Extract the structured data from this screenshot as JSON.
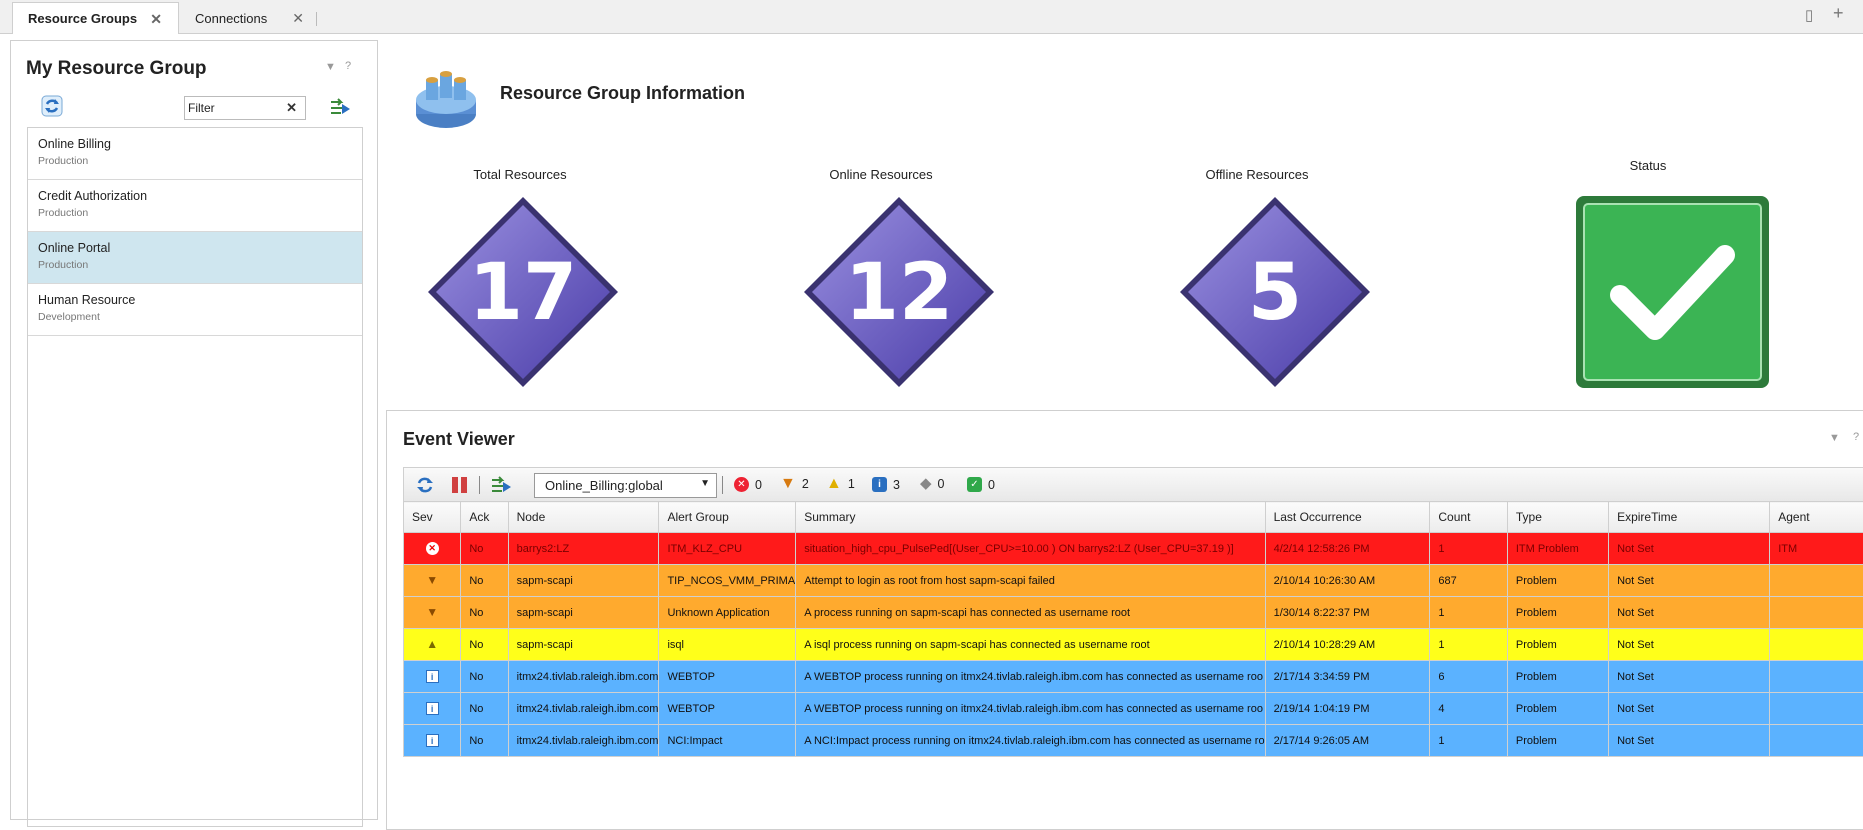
{
  "tabs": [
    {
      "label": "Resource Groups"
    },
    {
      "label": "Connections"
    }
  ],
  "left_panel": {
    "title": "My Resource Group",
    "filter_value": "Filter",
    "groups": [
      {
        "name": "Online Billing",
        "env": "Production"
      },
      {
        "name": "Credit Authorization",
        "env": "Production"
      },
      {
        "name": "Online Portal",
        "env": "Production"
      },
      {
        "name": "Human Resource",
        "env": "Development"
      }
    ]
  },
  "info": {
    "title": "Resource Group Information",
    "metrics": [
      {
        "label": "Total Resources",
        "value": "17"
      },
      {
        "label": "Online Resources",
        "value": "12"
      },
      {
        "label": "Offline Resources",
        "value": "5"
      }
    ],
    "status_label": "Status"
  },
  "event_viewer": {
    "title": "Event Viewer",
    "filter_select": "Online_Billing:global",
    "counts": {
      "critical": "0",
      "major": "2",
      "minor": "1",
      "info": "3",
      "indeterminate": "0",
      "clear": "0"
    },
    "columns": [
      "Sev",
      "Ack",
      "Node",
      "Alert Group",
      "Summary",
      "Last Occurrence",
      "Count",
      "Type",
      "ExpireTime",
      "Agent"
    ],
    "rows": [
      {
        "sev": "critical",
        "ack": "No",
        "node": "barrys2:LZ",
        "group": "ITM_KLZ_CPU",
        "summary": "situation_high_cpu_PulsePed[(User_CPU>=10.00 ) ON barrys2:LZ (User_CPU=37.19 )]",
        "last": "4/2/14 12:58:26 PM",
        "count": "1",
        "type": "ITM Problem",
        "expire": "Not Set",
        "agent": "ITM"
      },
      {
        "sev": "major",
        "ack": "No",
        "node": "sapm-scapi",
        "group": "TIP_NCOS_VMM_PRIMA",
        "summary": "Attempt to login as root from host sapm-scapi failed",
        "last": "2/10/14 10:26:30 AM",
        "count": "687",
        "type": "Problem",
        "expire": "Not Set",
        "agent": ""
      },
      {
        "sev": "major",
        "ack": "No",
        "node": "sapm-scapi",
        "group": "Unknown Application",
        "summary": "A process running on sapm-scapi has connected as username root",
        "last": "1/30/14 8:22:37 PM",
        "count": "1",
        "type": "Problem",
        "expire": "Not Set",
        "agent": ""
      },
      {
        "sev": "minor",
        "ack": "No",
        "node": "sapm-scapi",
        "group": "isql",
        "summary": "A isql process running on sapm-scapi has connected as username root",
        "last": "2/10/14 10:28:29 AM",
        "count": "1",
        "type": "Problem",
        "expire": "Not Set",
        "agent": ""
      },
      {
        "sev": "info",
        "ack": "No",
        "node": "itmx24.tivlab.raleigh.ibm.com",
        "group": "WEBTOP",
        "summary": "A WEBTOP process running on itmx24.tivlab.raleigh.ibm.com has connected as username roo",
        "last": "2/17/14 3:34:59 PM",
        "count": "6",
        "type": "Problem",
        "expire": "Not Set",
        "agent": ""
      },
      {
        "sev": "info",
        "ack": "No",
        "node": "itmx24.tivlab.raleigh.ibm.com",
        "group": "WEBTOP",
        "summary": "A WEBTOP process running on itmx24.tivlab.raleigh.ibm.com has connected as username roo",
        "last": "2/19/14 1:04:19 PM",
        "count": "4",
        "type": "Problem",
        "expire": "Not Set",
        "agent": ""
      },
      {
        "sev": "info",
        "ack": "No",
        "node": "itmx24.tivlab.raleigh.ibm.com",
        "group": "NCI:Impact",
        "summary": "A NCI:Impact process running on itmx24.tivlab.raleigh.ibm.com has connected as username ro",
        "last": "2/17/14 9:26:05 AM",
        "count": "1",
        "type": "Problem",
        "expire": "Not Set",
        "agent": ""
      }
    ]
  },
  "colors": {
    "critical": "#ff1a1a",
    "major": "#ffaa2e",
    "minor": "#ffff1a",
    "info": "#5bb2ff",
    "diamond": "#6a5cc4",
    "status_ok": "#2fa84a"
  }
}
